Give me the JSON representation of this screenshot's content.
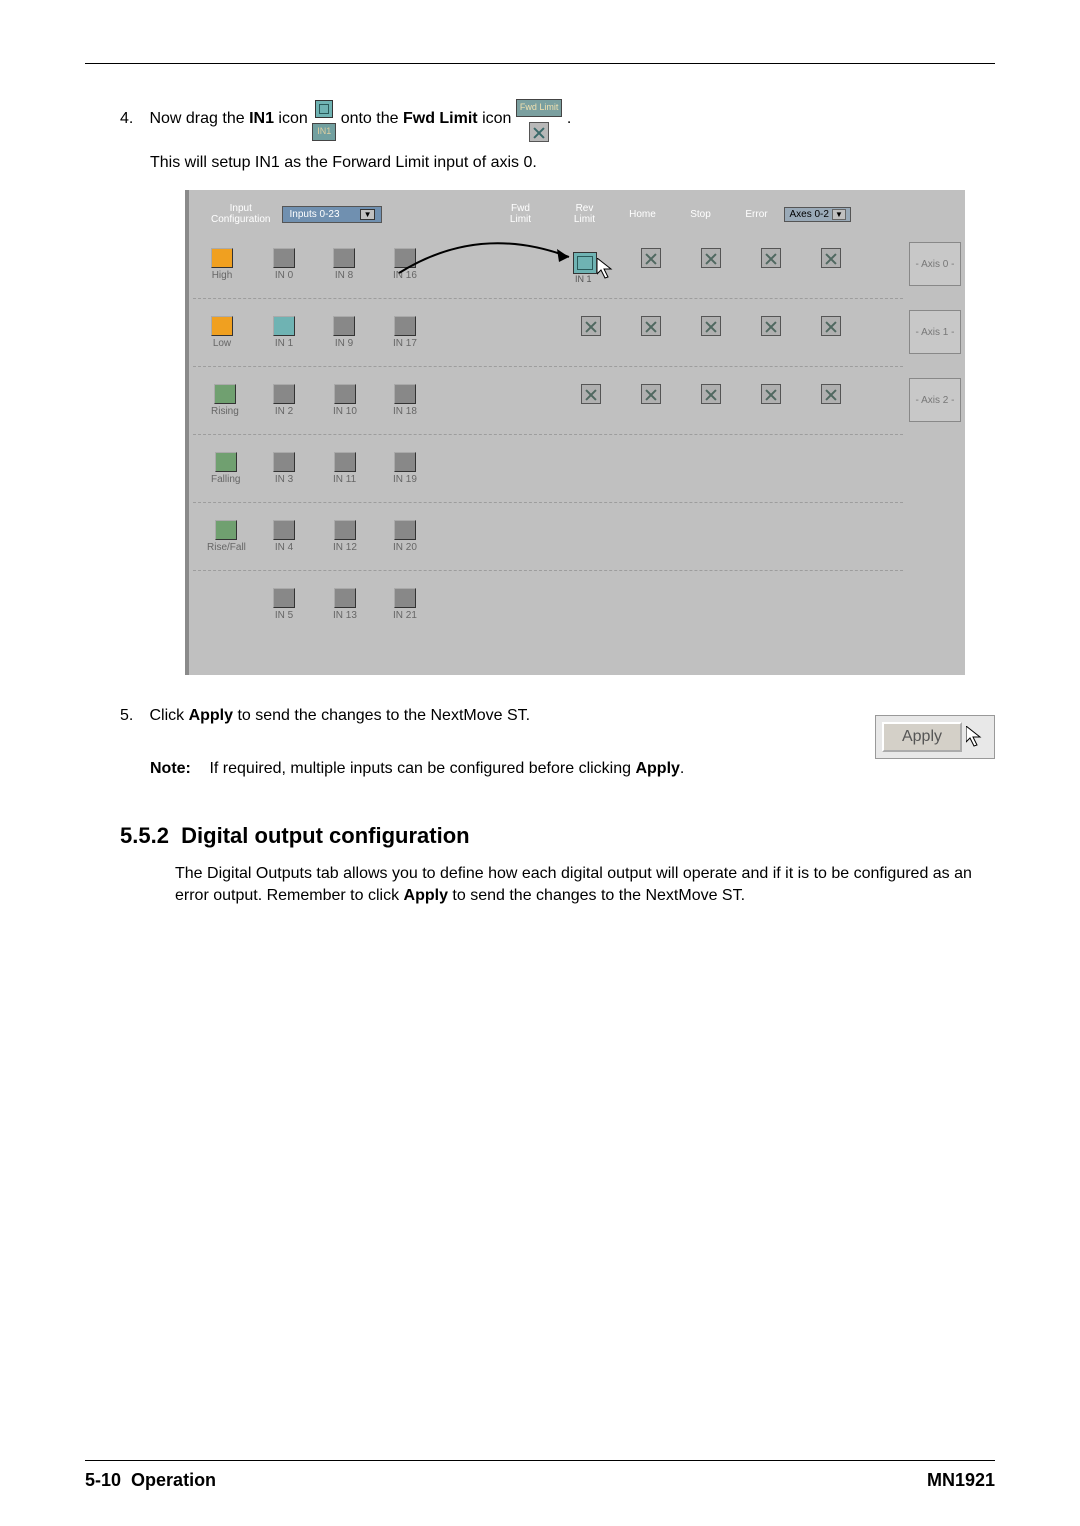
{
  "step4": {
    "num": "4.",
    "text1": "Now drag the ",
    "bold_in1": "IN1",
    "text2": " icon ",
    "text3": " onto the ",
    "bold_fwd": "Fwd Limit",
    "text4": " icon ",
    "period": ".",
    "in1_labeltext": "IN1",
    "fwd_labeltext": "Fwd Limit"
  },
  "setup_text": "This will setup IN1 as the Forward Limit input of axis 0.",
  "panel": {
    "header": {
      "input_conf_l1": "Input",
      "input_conf_l2": "Configuration",
      "dropdown": "Inputs 0-23",
      "cols": {
        "fwd": "Fwd\nLimit",
        "rev": "Rev\nLimit",
        "home": "Home",
        "stop": "Stop",
        "error": "Error"
      },
      "axis_dd": "Axes 0-2"
    },
    "rows_left": [
      {
        "name": "High",
        "type": "orange",
        "cells": [
          "IN 0",
          "IN 8",
          "IN 16"
        ]
      },
      {
        "name": "Low",
        "type": "orange-low",
        "cells": [
          "IN 1",
          "IN 9",
          "IN 17"
        ]
      },
      {
        "name": "Rising",
        "type": "green",
        "cells": [
          "IN 2",
          "IN 10",
          "IN 18"
        ]
      },
      {
        "name": "Falling",
        "type": "green",
        "cells": [
          "IN 3",
          "IN 11",
          "IN 19"
        ]
      },
      {
        "name": "Rise/Fall",
        "type": "green",
        "cells": [
          "IN 4",
          "IN 12",
          "IN 20"
        ]
      },
      {
        "name": "",
        "type": "none",
        "cells": [
          "IN 5",
          "IN 13",
          "IN 21"
        ]
      }
    ],
    "axes": [
      "- Axis 0 -",
      "- Axis 1 -",
      "- Axis 2 -"
    ],
    "drag_label": "IN 1"
  },
  "step5": {
    "num": "5.",
    "text1": "Click ",
    "bold_apply": "Apply",
    "text2": " to send the changes to the NextMove ST."
  },
  "apply_btn": "Apply",
  "note": {
    "label": "Note:",
    "text1": "If required, multiple inputs can be configured before clicking ",
    "bold_apply": "Apply",
    "period": "."
  },
  "section": {
    "num": "5.5.2",
    "title": "Digital output configuration",
    "body_part1": "The Digital Outputs tab allows you to define how each digital output will operate and if it is to be configured as an error output. Remember to click ",
    "bold_apply": "Apply",
    "body_part2": " to send the changes to the NextMove ST."
  },
  "footer": {
    "left_page": "5-10",
    "left_title": "Operation",
    "right": "MN1921"
  }
}
